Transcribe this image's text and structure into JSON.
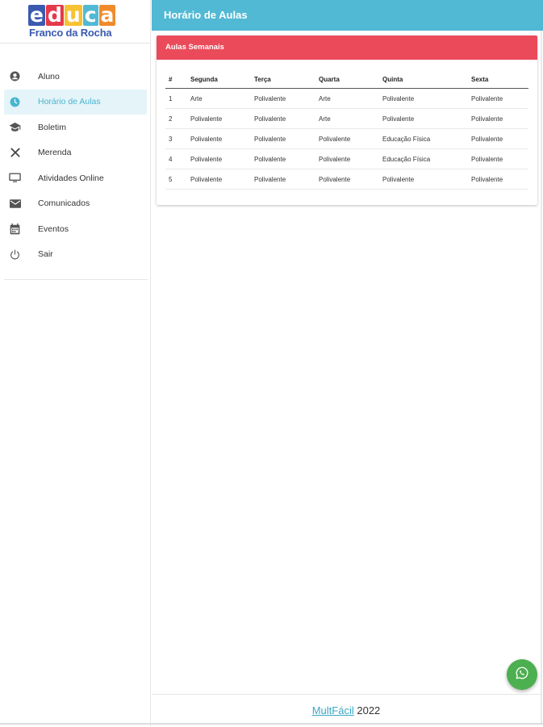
{
  "logo": {
    "letters": [
      "e",
      "d",
      "u",
      "c",
      "a"
    ],
    "colors": [
      "#3a5ab0",
      "#e6394b",
      "#f7c233",
      "#52b9d4",
      "#f08a2a"
    ],
    "subtitle": "Franco da Rocha"
  },
  "sidebar": {
    "items": [
      {
        "label": "Aluno",
        "icon": "account-icon"
      },
      {
        "label": "Horário de Aulas",
        "icon": "clock-icon",
        "active": true
      },
      {
        "label": "Boletim",
        "icon": "graduation-cap-icon"
      },
      {
        "label": "Merenda",
        "icon": "utensils-icon"
      },
      {
        "label": "Atividades Online",
        "icon": "monitor-icon"
      },
      {
        "label": "Comunicados",
        "icon": "mail-icon"
      },
      {
        "label": "Eventos",
        "icon": "calendar-icon"
      },
      {
        "label": "Sair",
        "icon": "power-icon"
      }
    ]
  },
  "header": {
    "title": "Horário de Aulas"
  },
  "card": {
    "title": "Aulas Semanais"
  },
  "table": {
    "headers": [
      "#",
      "Segunda",
      "Terça",
      "Quarta",
      "Quinta",
      "Sexta"
    ],
    "rows": [
      [
        "1",
        "Arte",
        "Polivalente",
        "Arte",
        "Polivalente",
        "Polivalente"
      ],
      [
        "2",
        "Polivalente",
        "Polivalente",
        "Arte",
        "Polivalente",
        "Polivalente"
      ],
      [
        "3",
        "Polivalente",
        "Polivalente",
        "Polivalente",
        "Educação Física",
        "Polivalente"
      ],
      [
        "4",
        "Polivalente",
        "Polivalente",
        "Polivalente",
        "Educação Física",
        "Polivalente"
      ],
      [
        "5",
        "Polivalente",
        "Polivalente",
        "Polivalente",
        "Polivalente",
        "Polivalente"
      ]
    ]
  },
  "footer": {
    "link": "MultFácil",
    "year": "2022"
  },
  "fab": {
    "icon": "whatsapp-icon"
  },
  "colors": {
    "accent": "#52b9d4",
    "card_header": "#ea4a5a",
    "fab": "#4caf50"
  }
}
